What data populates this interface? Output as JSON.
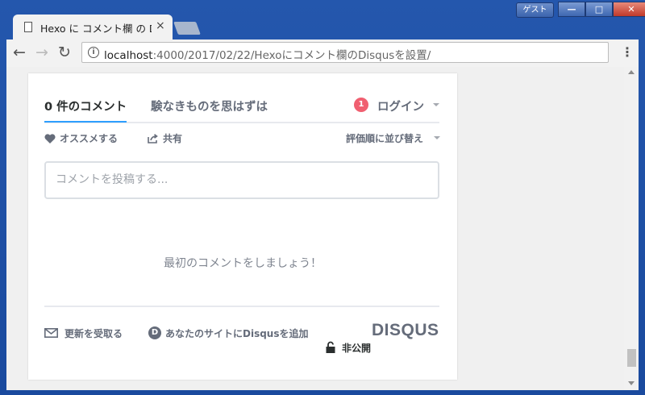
{
  "window": {
    "guest_label": "ゲスト",
    "buttons": {
      "minimize": "—",
      "maximize": "□",
      "close": "✕"
    }
  },
  "tab": {
    "title": "Hexo に コメント欄 の Disqus",
    "close": "×"
  },
  "toolbar": {
    "url_host": "localhost",
    "url_rest": ":4000/2017/02/22/Hexoにコメント欄のDisqusを設置/",
    "menu_glyph": "⋮",
    "info_glyph": "i",
    "back_glyph": "←",
    "forward_glyph": "→",
    "reload_glyph": "↻"
  },
  "disqus": {
    "tabs": {
      "count_label": "0 件のコメント",
      "community_label": "験なきものを思はずは"
    },
    "notification_count": "1",
    "login_label": "ログイン",
    "actions": {
      "recommend": "オススメする",
      "share": "共有",
      "sort": "評価順に並び替え"
    },
    "comment_box": {
      "placeholder": "コメントを投稿する..."
    },
    "empty_message": "最初のコメントをしましょう！",
    "footer": {
      "subscribe": "更新を受取る",
      "add_disqus": "あなたのサイトにDisqusを追加",
      "d_glyph": "D",
      "privacy": "非公開",
      "brand": "DISQUS"
    }
  },
  "colors": {
    "accent": "#2e9fff",
    "badge": "#f05f70",
    "text_dark": "#2a2e2e",
    "text_muted": "#656c7a"
  },
  "scroll": {
    "position_fraction": 0.9
  }
}
